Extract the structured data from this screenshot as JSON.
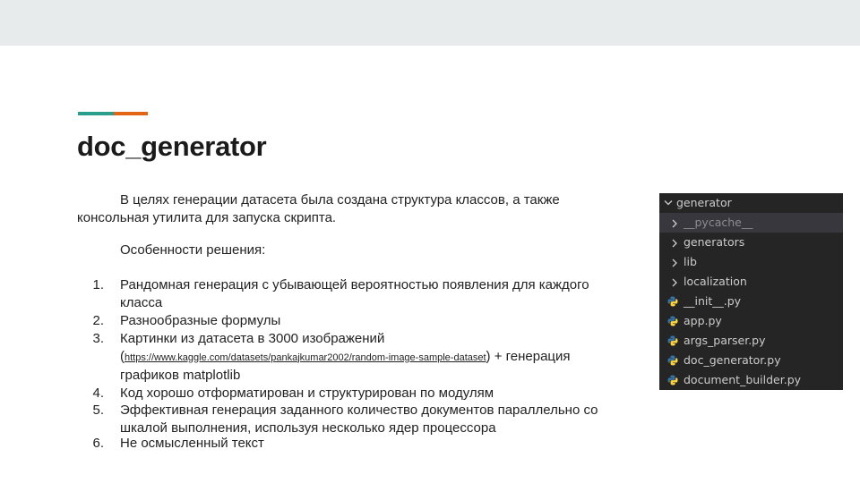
{
  "slide": {
    "title": "doc_generator",
    "accent_colors": {
      "teal": "#2a9d8f",
      "orange": "#e36414"
    },
    "intro": "В целях генерации датасета была создана структура классов, а также консольная утилита для запуска скрипта.",
    "features_heading": "Особенности решения:",
    "list": [
      {
        "num": "1.",
        "text": "Рандомная генерация с убывающей вероятностью появления для каждого класса"
      },
      {
        "num": "2.",
        "text": "Разнообразные формулы"
      },
      {
        "num": "3.",
        "pre": "Картинки из датасета в 3000 изображений (",
        "link": "https://www.kaggle.com/datasets/pankajkumar2002/random-image-sample-dataset",
        "post": ") + генерация графиков matplotlib"
      },
      {
        "num": "4.",
        "text": "Код хорошо отформатирован и структурирован по модулям"
      },
      {
        "num": "5.",
        "text": "Эффективная генерация заданного количество документов параллельно со шкалой выполнения, используя несколько ядер процессора"
      },
      {
        "num": "6.",
        "text": "Не осмысленный текст"
      }
    ]
  },
  "explorer": {
    "root": "generator",
    "items": [
      {
        "label": "__pycache__",
        "type": "folder",
        "icon": "chevron-right-icon",
        "selected": true
      },
      {
        "label": "generators",
        "type": "folder",
        "icon": "chevron-right-icon"
      },
      {
        "label": "lib",
        "type": "folder",
        "icon": "chevron-right-icon"
      },
      {
        "label": "localization",
        "type": "folder",
        "icon": "chevron-right-icon"
      },
      {
        "label": "__init__.py",
        "type": "file",
        "icon": "python-icon"
      },
      {
        "label": "app.py",
        "type": "file",
        "icon": "python-icon"
      },
      {
        "label": "args_parser.py",
        "type": "file",
        "icon": "python-icon"
      },
      {
        "label": "doc_generator.py",
        "type": "file",
        "icon": "python-icon"
      },
      {
        "label": "document_builder.py",
        "type": "file",
        "icon": "python-icon"
      }
    ],
    "colors": {
      "background": "#252526",
      "selected": "#37373d",
      "python_blue": "#3572a5",
      "python_yellow": "#ffd43b"
    }
  }
}
